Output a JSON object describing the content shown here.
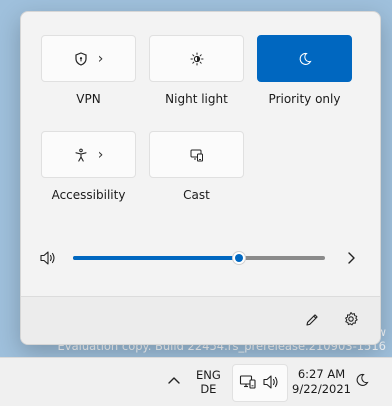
{
  "desktop": {
    "watermark_line1": "w",
    "watermark_line2": "Evaluation copy. Build 22454.rs_prerelease.210903-1516"
  },
  "quick_settings": {
    "tiles": [
      {
        "label": "VPN",
        "icon": "shield-icon",
        "has_chevron": true,
        "active": false
      },
      {
        "label": "Night light",
        "icon": "brightness-icon",
        "has_chevron": false,
        "active": false
      },
      {
        "label": "Priority only",
        "icon": "moon-icon",
        "has_chevron": false,
        "active": true
      },
      {
        "label": "Accessibility",
        "icon": "accessibility-icon",
        "has_chevron": true,
        "active": false
      },
      {
        "label": "Cast",
        "icon": "cast-icon",
        "has_chevron": false,
        "active": false
      }
    ],
    "volume": {
      "level": 0.66,
      "icon": "speaker-icon"
    },
    "footer": {
      "edit_icon": "pencil-icon",
      "settings_icon": "gear-icon"
    }
  },
  "taskbar": {
    "lang_line1": "ENG",
    "lang_line2": "DE",
    "time": "6:27 AM",
    "date": "9/22/2021"
  },
  "colors": {
    "accent": "#0067c0",
    "desktop": "#9fc0dc"
  }
}
